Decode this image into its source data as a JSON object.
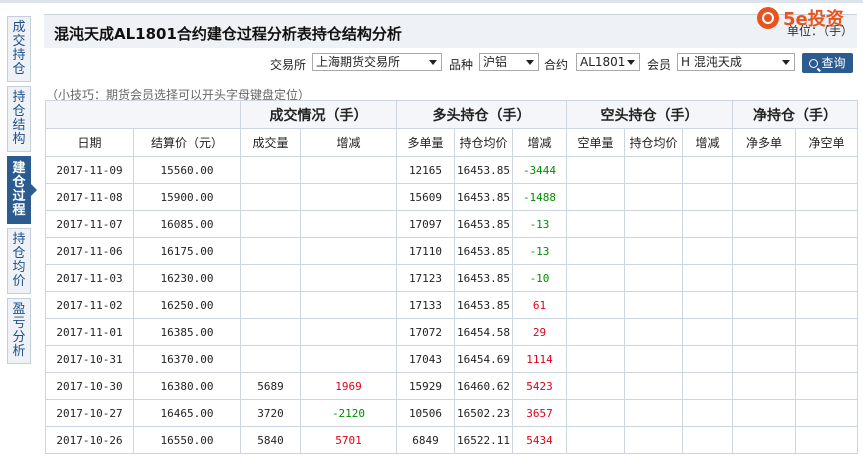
{
  "tabs": [
    {
      "label": "成交持仓",
      "chars": [
        "成",
        "交",
        "持",
        "仓"
      ],
      "active": false
    },
    {
      "label": "持仓结构",
      "chars": [
        "持",
        "仓",
        "结",
        "构"
      ],
      "active": false
    },
    {
      "label": "建仓过程",
      "chars": [
        "建",
        "仓",
        "过",
        "程"
      ],
      "active": true
    },
    {
      "label": "持仓均价",
      "chars": [
        "持",
        "仓",
        "均",
        "价"
      ],
      "active": false
    },
    {
      "label": "盈亏分析",
      "chars": [
        "盈",
        "亏",
        "分",
        "析"
      ],
      "active": false
    }
  ],
  "header": {
    "title": "混沌天成AL1801合约建仓过程分析表持仓结构分析",
    "logo_text": "5e投资",
    "unit": "单位：（手）"
  },
  "filters": {
    "exchange_label": "交易所",
    "exchange_value": "上海期货交易所",
    "variety_label": "品种",
    "variety_value": "沪铝",
    "contract_label": "合约",
    "contract_value": "AL1801",
    "member_label": "会员",
    "member_value": "H 混沌天成",
    "query_label": "查询"
  },
  "tip": "（小技巧：期货会员选择可以开头字母键盘定位）",
  "table": {
    "groups": {
      "deal": "成交情况（手）",
      "long": "多头持仓（手）",
      "short": "空头持仓（手）",
      "net": "净持仓（手）"
    },
    "columns": {
      "date": "日期",
      "settle": "结算价（元）",
      "volume": "成交量",
      "vol_change": "增减",
      "long_qty": "多单量",
      "long_avg": "持仓均价",
      "long_change": "增减",
      "short_qty": "空单量",
      "short_avg": "持仓均价",
      "short_change": "增减",
      "net_long": "净多单",
      "net_short": "净空单"
    },
    "rows": [
      {
        "date": "2017-11-09",
        "settle": "15560.00",
        "volume": "",
        "vol_change": "",
        "vol_dir": "",
        "long_qty": "12165",
        "long_avg": "16453.85",
        "long_change": "-3444",
        "long_dir": "dn"
      },
      {
        "date": "2017-11-08",
        "settle": "15900.00",
        "volume": "",
        "vol_change": "",
        "vol_dir": "",
        "long_qty": "15609",
        "long_avg": "16453.85",
        "long_change": "-1488",
        "long_dir": "dn"
      },
      {
        "date": "2017-11-07",
        "settle": "16085.00",
        "volume": "",
        "vol_change": "",
        "vol_dir": "",
        "long_qty": "17097",
        "long_avg": "16453.85",
        "long_change": "-13",
        "long_dir": "dn"
      },
      {
        "date": "2017-11-06",
        "settle": "16175.00",
        "volume": "",
        "vol_change": "",
        "vol_dir": "",
        "long_qty": "17110",
        "long_avg": "16453.85",
        "long_change": "-13",
        "long_dir": "dn"
      },
      {
        "date": "2017-11-03",
        "settle": "16230.00",
        "volume": "",
        "vol_change": "",
        "vol_dir": "",
        "long_qty": "17123",
        "long_avg": "16453.85",
        "long_change": "-10",
        "long_dir": "dn"
      },
      {
        "date": "2017-11-02",
        "settle": "16250.00",
        "volume": "",
        "vol_change": "",
        "vol_dir": "",
        "long_qty": "17133",
        "long_avg": "16453.85",
        "long_change": "61",
        "long_dir": "up"
      },
      {
        "date": "2017-11-01",
        "settle": "16385.00",
        "volume": "",
        "vol_change": "",
        "vol_dir": "",
        "long_qty": "17072",
        "long_avg": "16454.58",
        "long_change": "29",
        "long_dir": "up"
      },
      {
        "date": "2017-10-31",
        "settle": "16370.00",
        "volume": "",
        "vol_change": "",
        "vol_dir": "",
        "long_qty": "17043",
        "long_avg": "16454.69",
        "long_change": "1114",
        "long_dir": "up"
      },
      {
        "date": "2017-10-30",
        "settle": "16380.00",
        "volume": "5689",
        "vol_change": "1969",
        "vol_dir": "up",
        "long_qty": "15929",
        "long_avg": "16460.62",
        "long_change": "5423",
        "long_dir": "up"
      },
      {
        "date": "2017-10-27",
        "settle": "16465.00",
        "volume": "3720",
        "vol_change": "-2120",
        "vol_dir": "dn",
        "long_qty": "10506",
        "long_avg": "16502.23",
        "long_change": "3657",
        "long_dir": "up"
      },
      {
        "date": "2017-10-26",
        "settle": "16550.00",
        "volume": "5840",
        "vol_change": "5701",
        "vol_dir": "up",
        "long_qty": "6849",
        "long_avg": "16522.11",
        "long_change": "5434",
        "long_dir": "up"
      }
    ]
  }
}
